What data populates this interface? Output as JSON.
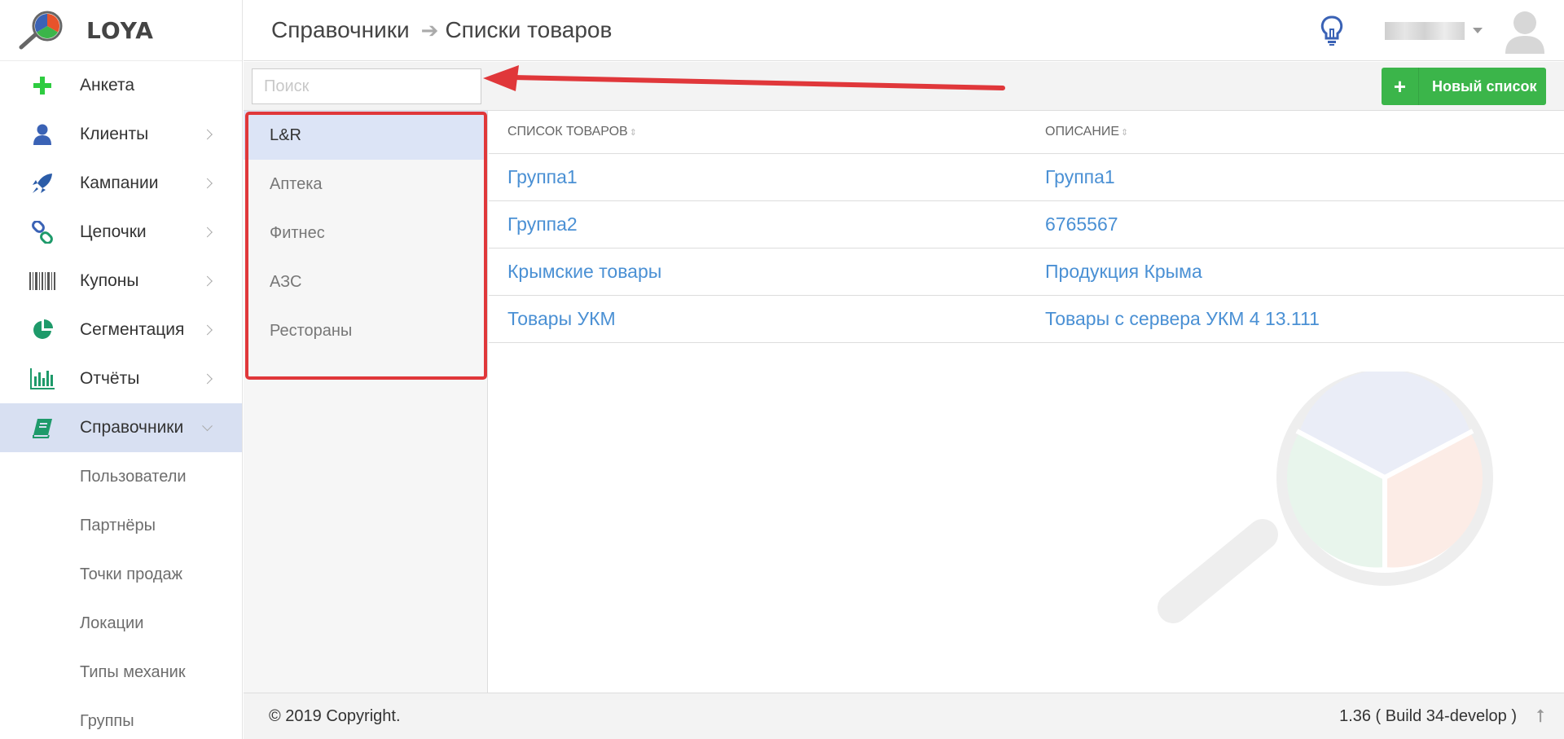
{
  "brand": {
    "name": "LOYA"
  },
  "sidebar": {
    "items": [
      {
        "label": "Анкета",
        "icon": "plus-icon",
        "color": "#2ecc40",
        "has_children": false
      },
      {
        "label": "Клиенты",
        "icon": "person-icon",
        "color": "#3a62b5",
        "has_children": true
      },
      {
        "label": "Кампании",
        "icon": "rocket-icon",
        "color": "#2b5ca8",
        "has_children": true
      },
      {
        "label": "Цепочки",
        "icon": "chain-link-icon",
        "color": "#3a62b5",
        "has_children": true
      },
      {
        "label": "Купоны",
        "icon": "barcode-icon",
        "color": "#555555",
        "has_children": true
      },
      {
        "label": "Сегментация",
        "icon": "pie-chart-icon",
        "color": "#1e9a6a",
        "has_children": true
      },
      {
        "label": "Отчёты",
        "icon": "bar-chart-icon",
        "color": "#1e9a6a",
        "has_children": true
      },
      {
        "label": "Справочники",
        "icon": "book-icon",
        "color": "#1e9a6a",
        "has_children": true,
        "active": true
      }
    ],
    "sub_items": [
      "Пользователи",
      "Партнёры",
      "Точки продаж",
      "Локации",
      "Типы механик",
      "Группы"
    ]
  },
  "header": {
    "breadcrumb_parent": "Справочники",
    "breadcrumb_current": "Списки товаров"
  },
  "toolbar": {
    "search_placeholder": "Поиск",
    "new_button_label": "Новый список"
  },
  "lists": [
    "L&R",
    "Аптека",
    "Фитнес",
    "АЗС",
    "Рестораны"
  ],
  "table": {
    "columns": [
      "СПИСОК ТОВАРОВ",
      "ОПИСАНИЕ"
    ],
    "rows": [
      [
        "Группа1",
        "Группа1"
      ],
      [
        "Группа2",
        "6765567"
      ],
      [
        "Крымские товары",
        "Продукция Крыма"
      ],
      [
        "Товары УКМ",
        "Товары с сервера УКМ 4 13.111"
      ]
    ]
  },
  "footer": {
    "copyright": "© 2019 Copyright.",
    "version": "1.36 ( Build 34-develop )"
  },
  "colors": {
    "accent_green": "#3bb54a",
    "link_blue": "#4a90d4",
    "active_bg": "#d8e0f2",
    "annotation_red": "#e0373a"
  }
}
